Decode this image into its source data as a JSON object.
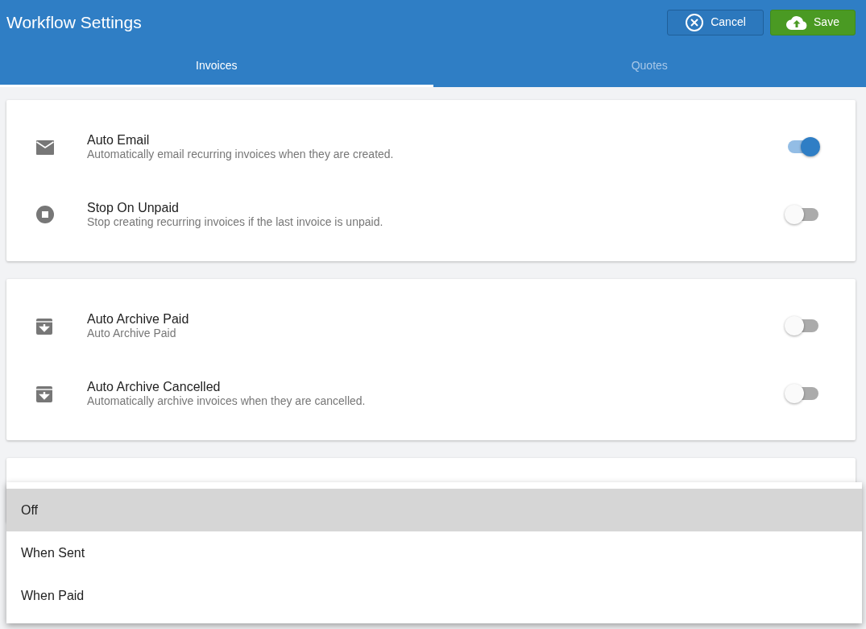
{
  "header": {
    "title": "Workflow Settings",
    "buttons": [
      {
        "label": "Cancel",
        "kind": "cancel"
      },
      {
        "label": "Save",
        "kind": "save"
      }
    ]
  },
  "tabs": [
    {
      "label": "Invoices",
      "selected": true
    },
    {
      "label": "Quotes",
      "selected": false
    }
  ],
  "cards": [
    {
      "settings": [
        {
          "kind": "email",
          "title": "Auto Email",
          "description": "Automatically email recurring invoices when they are created.",
          "on": true
        },
        {
          "kind": "stop",
          "title": "Stop On Unpaid",
          "description": "Stop creating recurring invoices if the last invoice is unpaid.",
          "on": false
        }
      ]
    },
    {
      "settings": [
        {
          "kind": "archive",
          "title": "Auto Archive Paid",
          "description": "Auto Archive Paid",
          "on": false
        },
        {
          "kind": "archive",
          "title": "Auto Archive Cancelled",
          "description": "Automatically archive invoices when they are cancelled.",
          "on": false
        }
      ]
    }
  ],
  "dropdown_menu": {
    "options": [
      {
        "label": "Off",
        "selected": true
      },
      {
        "label": "When Sent",
        "selected": false
      },
      {
        "label": "When Paid",
        "selected": false
      }
    ]
  }
}
